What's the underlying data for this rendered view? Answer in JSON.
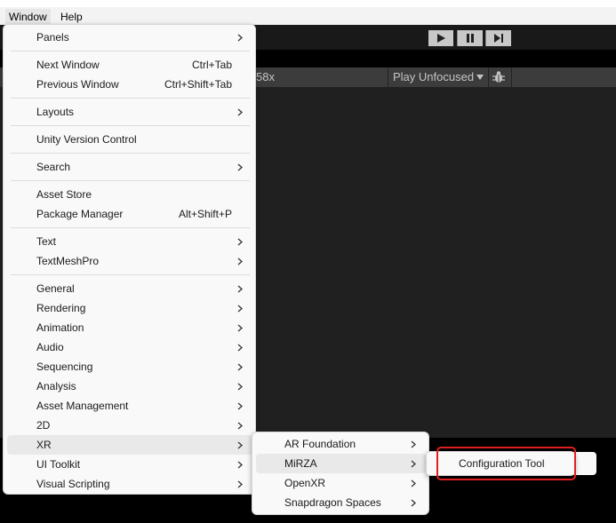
{
  "menubar": {
    "items": [
      {
        "label": "Window"
      },
      {
        "label": "Help"
      }
    ]
  },
  "gamebar": {
    "scale_text": "58x",
    "play_mode": "Play Unfocused"
  },
  "window_menu": {
    "items": [
      {
        "label": "Panels",
        "submenu": true
      },
      {
        "label": "Next Window",
        "shortcut": "Ctrl+Tab"
      },
      {
        "label": "Previous Window",
        "shortcut": "Ctrl+Shift+Tab"
      },
      {
        "label": "Layouts",
        "submenu": true
      },
      {
        "label": "Unity Version Control"
      },
      {
        "label": "Search",
        "submenu": true
      },
      {
        "label": "Asset Store"
      },
      {
        "label": "Package Manager",
        "shortcut": "Alt+Shift+P"
      },
      {
        "label": "Text",
        "submenu": true
      },
      {
        "label": "TextMeshPro",
        "submenu": true
      },
      {
        "label": "General",
        "submenu": true
      },
      {
        "label": "Rendering",
        "submenu": true
      },
      {
        "label": "Animation",
        "submenu": true
      },
      {
        "label": "Audio",
        "submenu": true
      },
      {
        "label": "Sequencing",
        "submenu": true
      },
      {
        "label": "Analysis",
        "submenu": true
      },
      {
        "label": "Asset Management",
        "submenu": true
      },
      {
        "label": "2D",
        "submenu": true
      },
      {
        "label": "XR",
        "submenu": true
      },
      {
        "label": "UI Toolkit",
        "submenu": true
      },
      {
        "label": "Visual Scripting",
        "submenu": true
      }
    ]
  },
  "xr_menu": {
    "items": [
      {
        "label": "AR Foundation",
        "submenu": true
      },
      {
        "label": "MiRZA",
        "submenu": true
      },
      {
        "label": "OpenXR",
        "submenu": true
      },
      {
        "label": "Snapdragon Spaces",
        "submenu": true
      }
    ]
  },
  "mirza_menu": {
    "items": [
      {
        "label": "Configuration Tool"
      }
    ]
  },
  "colors": {
    "highlight_box": "#e02020",
    "menu_bg": "#f9f9f9",
    "editor_bg": "#202020"
  },
  "icons": [
    "chevron-right-icon",
    "play-icon",
    "pause-icon",
    "step-icon",
    "dropdown-triangle-icon",
    "bug-icon"
  ]
}
